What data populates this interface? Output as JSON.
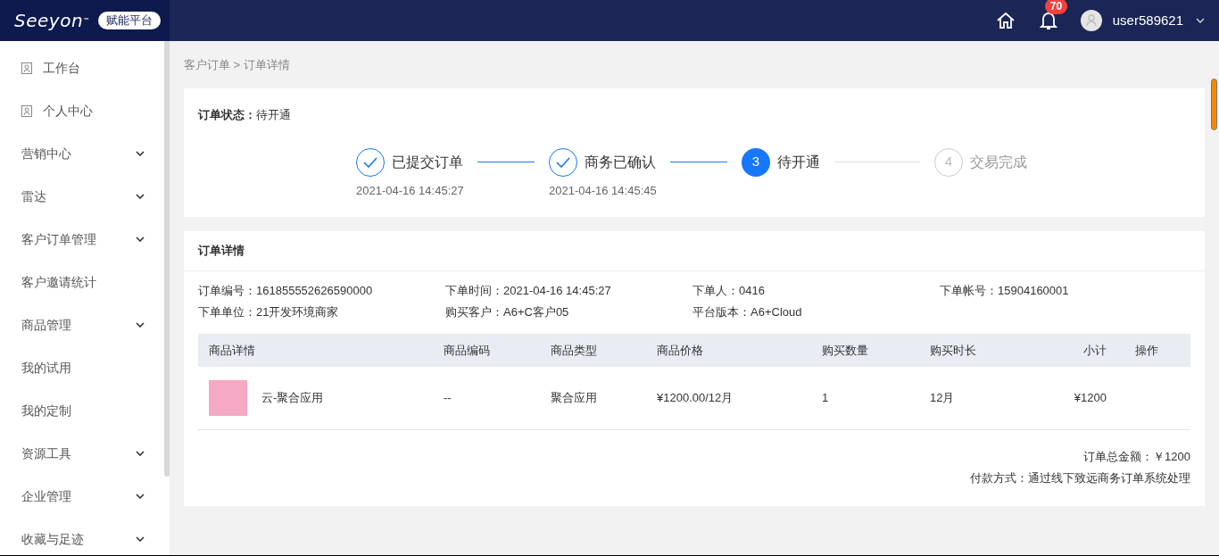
{
  "header": {
    "logo": "Seeyon",
    "trademark": "™",
    "platform_badge": "赋能平台",
    "notification_count": "70",
    "username": "user589621"
  },
  "sidebar": {
    "items": [
      {
        "label": "工作台",
        "kind": "page"
      },
      {
        "label": "个人中心",
        "kind": "page"
      },
      {
        "label": "营销中心",
        "kind": "group"
      },
      {
        "label": "雷达",
        "kind": "group"
      },
      {
        "label": "客户订单管理",
        "kind": "group"
      },
      {
        "label": "客户邀请统计",
        "kind": "plain"
      },
      {
        "label": "商品管理",
        "kind": "group"
      },
      {
        "label": "我的试用",
        "kind": "plain"
      },
      {
        "label": "我的定制",
        "kind": "plain"
      },
      {
        "label": "资源工具",
        "kind": "group"
      },
      {
        "label": "企业管理",
        "kind": "group"
      },
      {
        "label": "收藏与足迹",
        "kind": "group"
      }
    ]
  },
  "breadcrumb": "客户订单 > 订单详情",
  "order_status": {
    "label": "订单状态：",
    "value": "待开通"
  },
  "steps": [
    {
      "label": "已提交订单",
      "time": "2021-04-16 14:45:27",
      "kind": "done"
    },
    {
      "label": "商务已确认",
      "time": "2021-04-16 14:45:45",
      "kind": "done"
    },
    {
      "number": "3",
      "label": "待开通",
      "kind": "current"
    },
    {
      "number": "4",
      "label": "交易完成",
      "kind": "pending"
    }
  ],
  "details": {
    "title": "订单详情",
    "fields": [
      {
        "label": "订单编号：",
        "value": "161855552626590000"
      },
      {
        "label": "下单时间：",
        "value": "2021-04-16 14:45:27"
      },
      {
        "label": "下单人：",
        "value": "0416"
      },
      {
        "label": "下单帐号：",
        "value": "15904160001"
      },
      {
        "label": "下单单位：",
        "value": "21开发环境商家"
      },
      {
        "label": "购买客户：",
        "value": "A6+C客户05"
      },
      {
        "label": "平台版本：",
        "value": "A6+Cloud"
      }
    ]
  },
  "table": {
    "columns": [
      "商品详情",
      "商品编码",
      "商品类型",
      "商品价格",
      "购买数量",
      "购买时长",
      "小计",
      "操作"
    ],
    "rows": [
      [
        "云-聚合应用",
        "--",
        "聚合应用",
        "¥1200.00/12月",
        "1",
        "12月",
        "¥1200"
      ]
    ]
  },
  "summary": {
    "total": "订单总金额：￥1200",
    "payment": "付款方式：通过线下致远商务订单系统处理"
  }
}
